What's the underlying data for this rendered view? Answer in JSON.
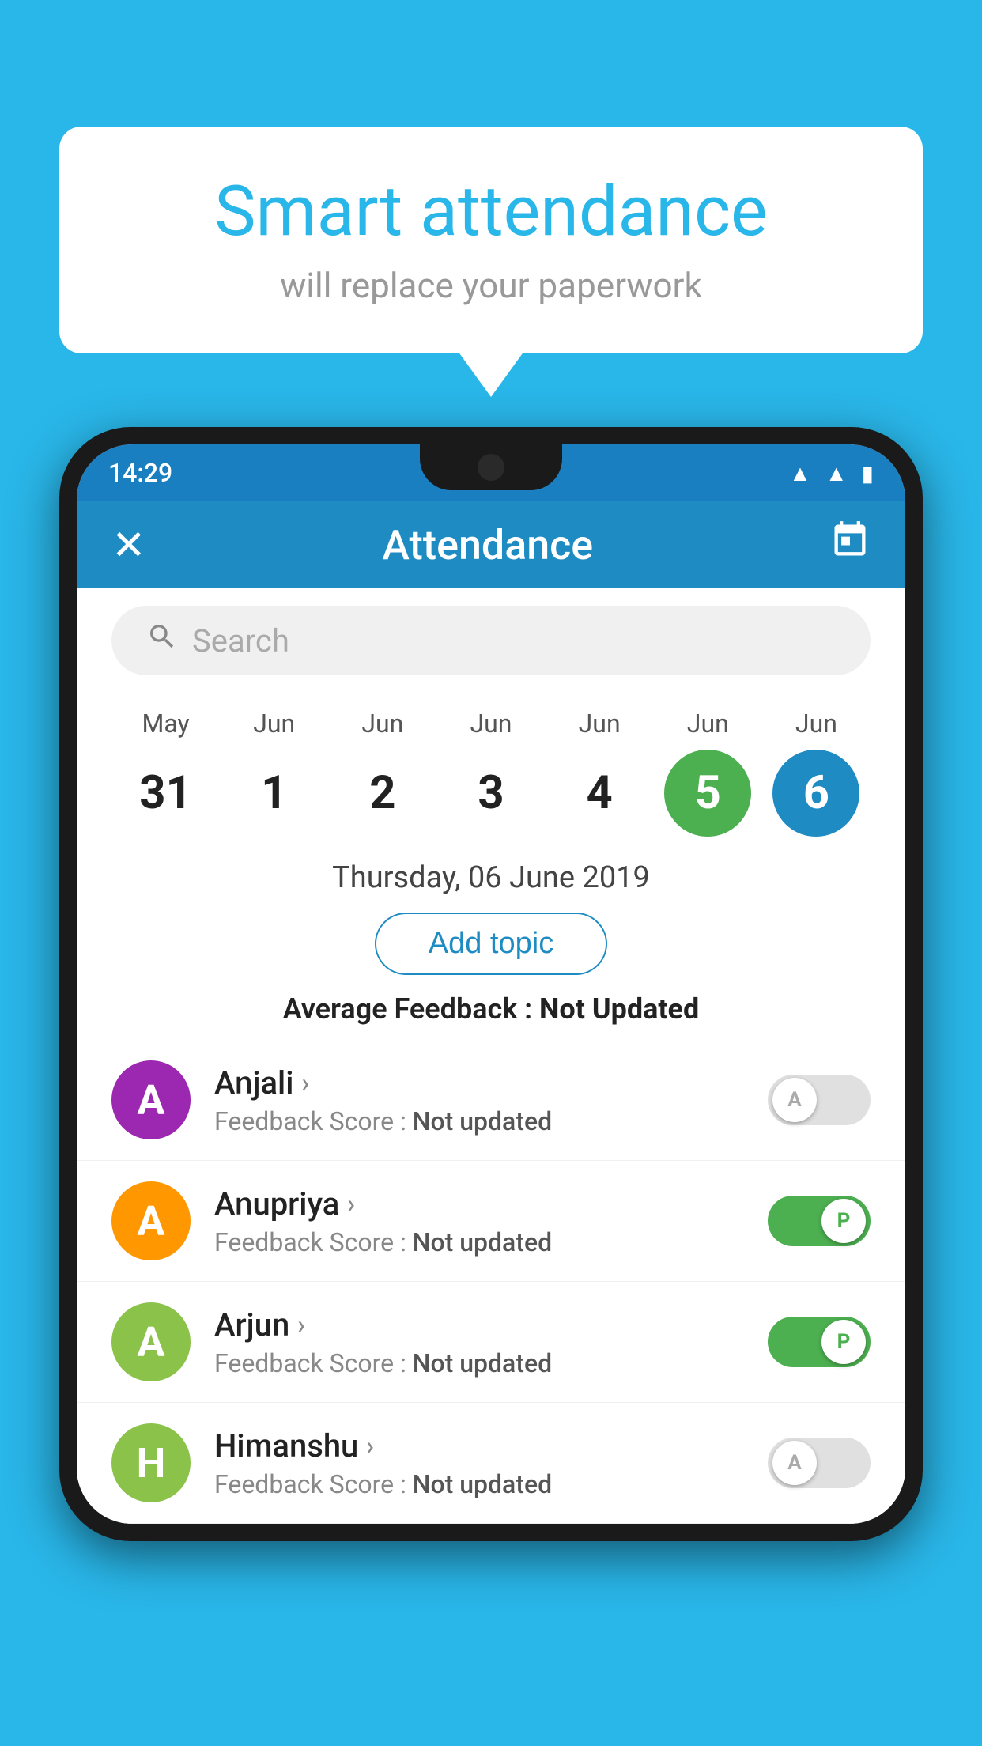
{
  "background_color": "#29b6e8",
  "speech_bubble": {
    "title": "Smart attendance",
    "subtitle": "will replace your paperwork"
  },
  "status_bar": {
    "time": "14:29",
    "wifi_icon": "▲",
    "signal_icon": "▲",
    "battery_icon": "▮"
  },
  "app_bar": {
    "title": "Attendance",
    "close_icon": "✕",
    "calendar_icon": "📅"
  },
  "search": {
    "placeholder": "Search"
  },
  "calendar": {
    "days": [
      {
        "month": "May",
        "date": "31",
        "type": "normal"
      },
      {
        "month": "Jun",
        "date": "1",
        "type": "normal"
      },
      {
        "month": "Jun",
        "date": "2",
        "type": "normal"
      },
      {
        "month": "Jun",
        "date": "3",
        "type": "normal"
      },
      {
        "month": "Jun",
        "date": "4",
        "type": "normal"
      },
      {
        "month": "Jun",
        "date": "5",
        "type": "today"
      },
      {
        "month": "Jun",
        "date": "6",
        "type": "selected"
      }
    ]
  },
  "selected_date": "Thursday, 06 June 2019",
  "add_topic_label": "Add topic",
  "average_feedback": {
    "label": "Average Feedback : ",
    "value": "Not Updated"
  },
  "students": [
    {
      "name": "Anjali",
      "avatar_letter": "A",
      "avatar_color": "#9c27b0",
      "feedback_label": "Feedback Score : ",
      "feedback_value": "Not updated",
      "attendance": "absent",
      "toggle_label": "A"
    },
    {
      "name": "Anupriya",
      "avatar_letter": "A",
      "avatar_color": "#ff9800",
      "feedback_label": "Feedback Score : ",
      "feedback_value": "Not updated",
      "attendance": "present",
      "toggle_label": "P"
    },
    {
      "name": "Arjun",
      "avatar_letter": "A",
      "avatar_color": "#8bc34a",
      "feedback_label": "Feedback Score : ",
      "feedback_value": "Not updated",
      "attendance": "present",
      "toggle_label": "P"
    },
    {
      "name": "Himanshu",
      "avatar_letter": "H",
      "avatar_color": "#8bc34a",
      "feedback_label": "Feedback Score : ",
      "feedback_value": "Not updated",
      "attendance": "absent",
      "toggle_label": "A"
    }
  ]
}
